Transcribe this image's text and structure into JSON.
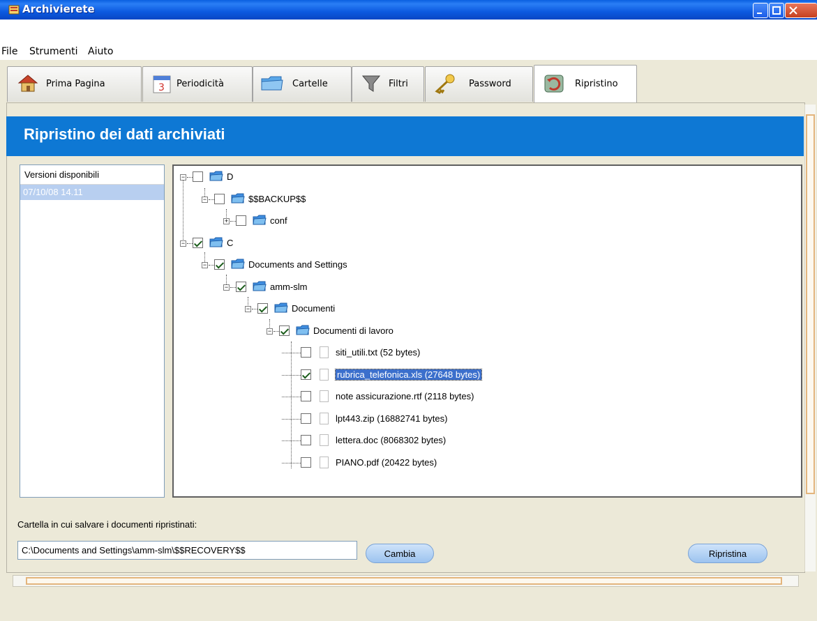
{
  "window": {
    "title": "Archivierete"
  },
  "menu": [
    "File",
    "Strumenti",
    "Aiuto"
  ],
  "tabs": [
    {
      "label": "Prima Pagina",
      "icon": "home-icon"
    },
    {
      "label": "Periodicità",
      "icon": "calendar-icon"
    },
    {
      "label": "Cartelle",
      "icon": "folder-icon"
    },
    {
      "label": "Filtri",
      "icon": "funnel-icon"
    },
    {
      "label": "Password",
      "icon": "key-icon"
    },
    {
      "label": "Ripristino",
      "icon": "restore-icon",
      "active": true
    }
  ],
  "header": {
    "title": "Ripristino dei dati archiviati"
  },
  "versions": {
    "header": "Versioni disponibili",
    "items": [
      "07/10/08 14.11"
    ]
  },
  "tree": {
    "nodes": [
      {
        "label": "D",
        "checked": false,
        "expanded": true,
        "kind": "folder"
      },
      {
        "label": "$$BACKUP$$",
        "checked": false,
        "expanded": true,
        "kind": "folder"
      },
      {
        "label": "conf",
        "checked": false,
        "expanded": false,
        "kind": "folder"
      },
      {
        "label": "C",
        "checked": true,
        "expanded": true,
        "kind": "folder"
      },
      {
        "label": "Documents and Settings",
        "checked": true,
        "expanded": true,
        "kind": "folder"
      },
      {
        "label": "amm-slm",
        "checked": true,
        "expanded": true,
        "kind": "folder"
      },
      {
        "label": "Documenti",
        "checked": true,
        "expanded": true,
        "kind": "folder"
      },
      {
        "label": "Documenti di lavoro",
        "checked": true,
        "expanded": true,
        "kind": "folder"
      },
      {
        "label": "siti_utili.txt (52 bytes)",
        "checked": false,
        "kind": "file"
      },
      {
        "label": "rubrica_telefonica.xls (27648 bytes)",
        "checked": true,
        "kind": "file",
        "selected": true
      },
      {
        "label": "note assicurazione.rtf (2118 bytes)",
        "checked": false,
        "kind": "file"
      },
      {
        "label": "lpt443.zip (16882741 bytes)",
        "checked": false,
        "kind": "file"
      },
      {
        "label": "lettera.doc (8068302 bytes)",
        "checked": false,
        "kind": "file"
      },
      {
        "label": "PIANO.pdf (20422 bytes)",
        "checked": false,
        "kind": "file"
      }
    ]
  },
  "destination": {
    "label": "Cartella in cui salvare i documenti ripristinati:",
    "path": "C:\\Documents and Settings\\amm-slm\\$$RECOVERY$$",
    "change_label": "Cambia",
    "restore_label": "Ripristina"
  },
  "colors": {
    "header": "#0e78d4",
    "selection": "#3b6fcc",
    "titlebar": "#0a5fe0"
  }
}
